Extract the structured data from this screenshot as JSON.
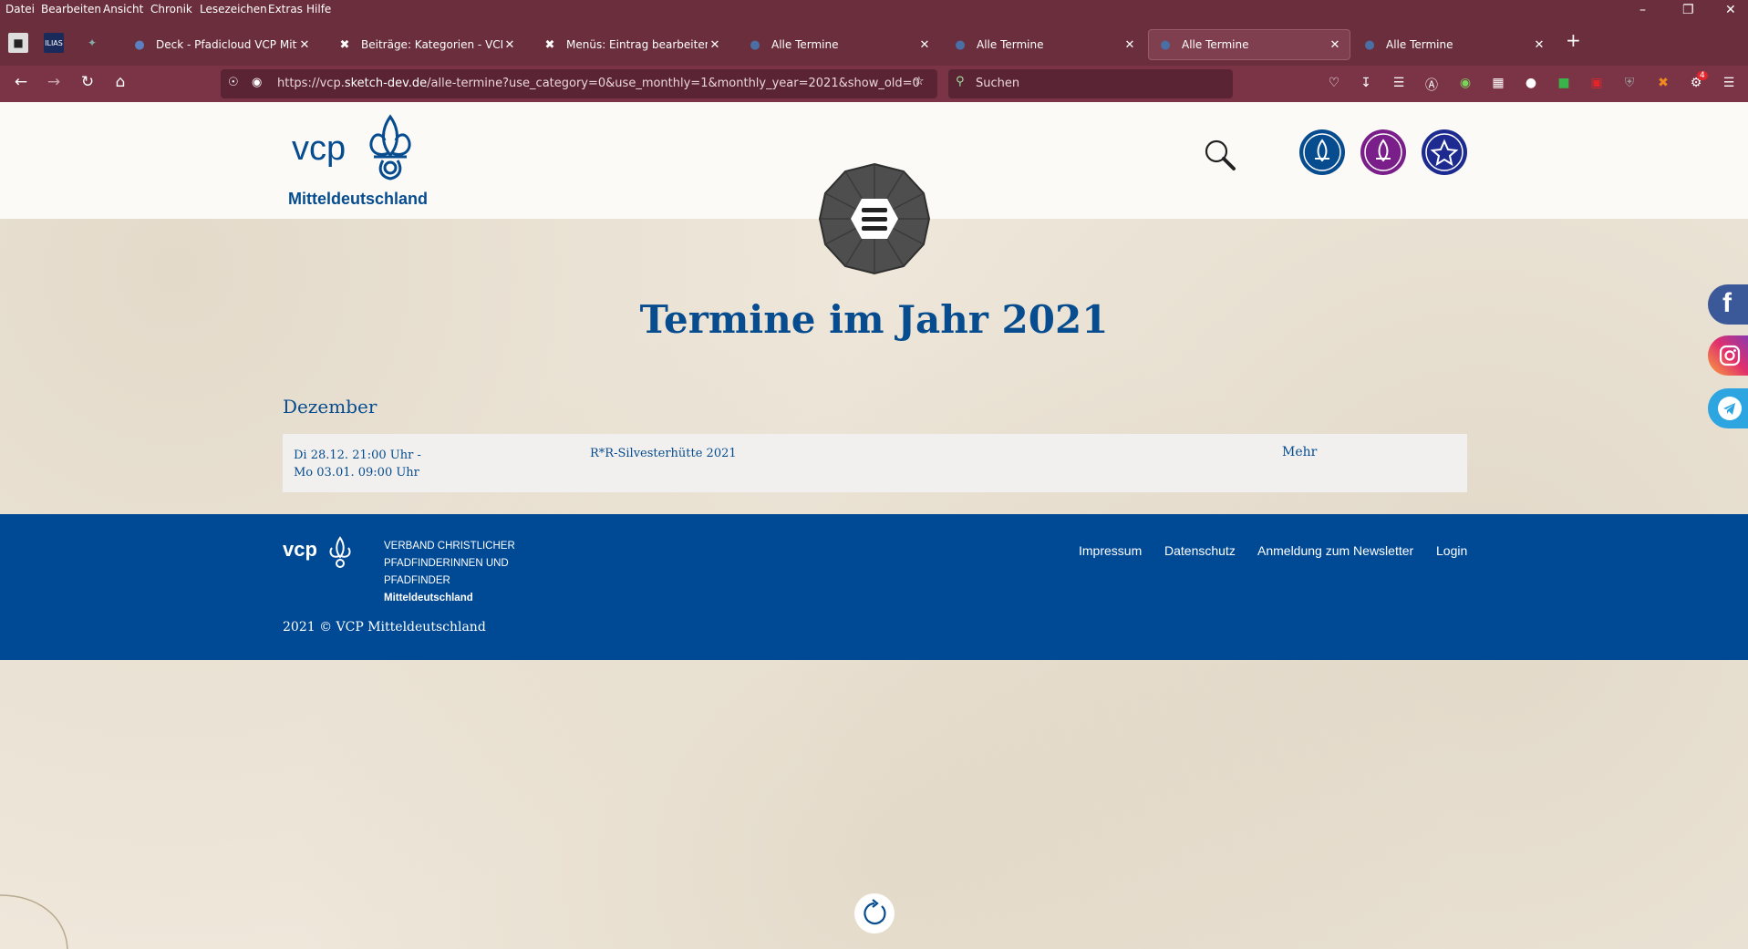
{
  "menubar": {
    "items": [
      "Datei",
      "Bearbeiten",
      "Ansicht",
      "Chronik",
      "Lesezeichen",
      "Extras",
      "Hilfe"
    ],
    "underline": [
      "D",
      "B",
      "A",
      "C",
      "L",
      "x",
      "H"
    ]
  },
  "tabs": [
    {
      "label": "Deck - Pfadicloud VCP Mitteld",
      "active": false
    },
    {
      "label": "Beiträge: Kategorien - VCP Mitt",
      "active": false
    },
    {
      "label": "Menüs: Eintrag bearbeiten - VCI",
      "active": false
    },
    {
      "label": "Alle Termine",
      "active": false
    },
    {
      "label": "Alle Termine",
      "active": false
    },
    {
      "label": "Alle Termine",
      "active": true
    },
    {
      "label": "Alle Termine",
      "active": false
    }
  ],
  "urlbar": {
    "prefix": "https://vcp.",
    "domain": "sketch-dev.de",
    "path": "/alle-termine?use_category=0&use_monthly=1&monthly_year=2021&show_old=0"
  },
  "searchbar": {
    "placeholder": "Suchen"
  },
  "notification_badge": "4",
  "site": {
    "logo_text": "vcp",
    "logo_subtitle": "Mitteldeutschland",
    "page_title": "Termine im Jahr 2021",
    "month": "Dezember",
    "events": [
      {
        "date_line1": "Di 28.12. 21:00 Uhr -",
        "date_line2": "Mo 03.01. 09:00 Uhr",
        "title": "R*R-Silvesterhütte 2021",
        "more": "Mehr"
      }
    ]
  },
  "footer": {
    "logo_text": "vcp",
    "org_line1": "VERBAND CHRISTLICHER",
    "org_line2": "PFADFINDERINNEN UND",
    "org_line3": "PFADFINDER",
    "org_line4": "Mitteldeutschland",
    "links": [
      "Impressum",
      "Datenschutz",
      "Anmeldung zum Newsletter",
      "Login"
    ],
    "copyright": "2021 © VCP Mitteldeutschland"
  },
  "colors": {
    "brand_blue": "#064c8f",
    "footer_blue": "#004995",
    "browser_bg": "#6b2e3c",
    "facebook": "#3b5998",
    "telegram": "#2ca5e0"
  }
}
